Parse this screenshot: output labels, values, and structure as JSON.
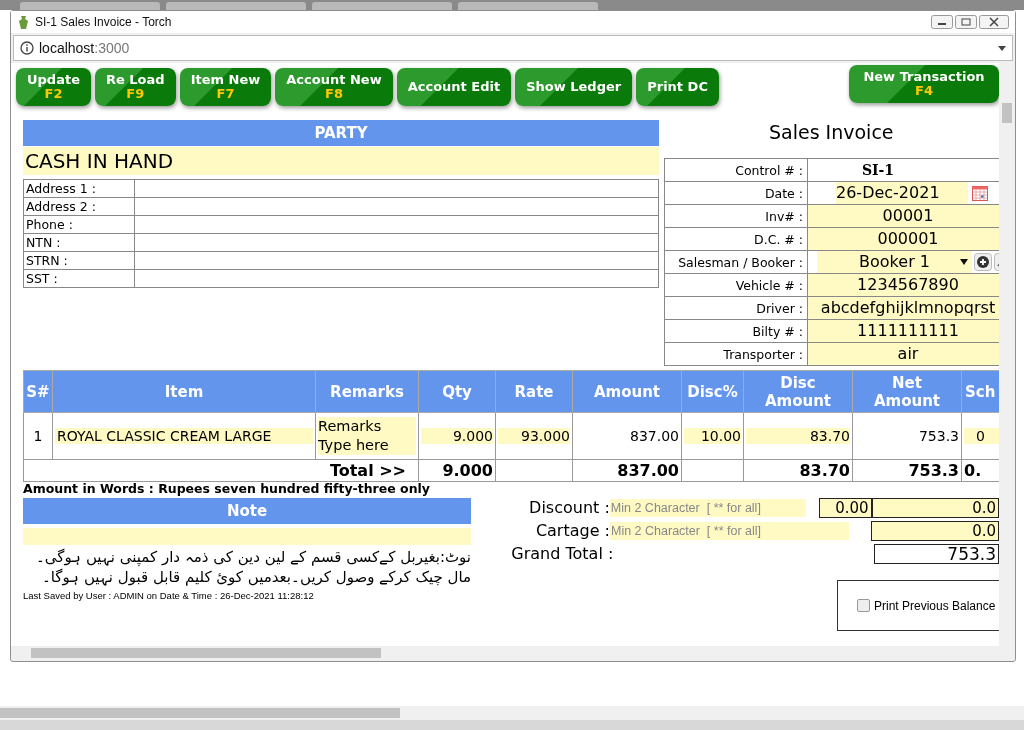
{
  "window": {
    "title": "SI-1 Sales Invoice - Torch"
  },
  "address_bar": {
    "host": "localhost",
    "port": ":3000"
  },
  "toolbar": [
    {
      "label": "Update",
      "shortcut": "F2"
    },
    {
      "label": "Re Load",
      "shortcut": "F9"
    },
    {
      "label": "Item New",
      "shortcut": "F7"
    },
    {
      "label": "Account New",
      "shortcut": "F8"
    },
    {
      "label": "Account Edit"
    },
    {
      "label": "Show Ledger"
    },
    {
      "label": "Print DC"
    }
  ],
  "new_transaction": {
    "label": "New Transaction",
    "shortcut": "F4"
  },
  "party": {
    "heading": "PARTY",
    "name": "CASH IN HAND",
    "fields": [
      {
        "label": "Address 1 :"
      },
      {
        "label": "Address 2 :"
      },
      {
        "label": "Phone :"
      },
      {
        "label": "NTN :"
      },
      {
        "label": "STRN :"
      },
      {
        "label": "SST :"
      }
    ]
  },
  "invoice": {
    "title": "Sales Invoice",
    "fields": [
      {
        "label": "Control # :",
        "kind": "static",
        "value": "SI-1"
      },
      {
        "label": "Date :",
        "kind": "date",
        "value": "26-Dec-2021"
      },
      {
        "label": "Inv# :",
        "kind": "input",
        "value": "00001"
      },
      {
        "label": "D.C. # :",
        "kind": "input",
        "value": "000001"
      },
      {
        "label": "Salesman / Booker :",
        "kind": "select",
        "value": "Booker 1"
      },
      {
        "label": "Vehicle # :",
        "kind": "input",
        "value": "1234567890"
      },
      {
        "label": "Driver :",
        "kind": "input",
        "value": "abcdefghijklmnopqrst"
      },
      {
        "label": "Bilty # :",
        "kind": "input",
        "value": "1111111111"
      },
      {
        "label": "Transporter :",
        "kind": "input",
        "value": "air"
      }
    ]
  },
  "table": {
    "columns": [
      "S#",
      "Item",
      "Remarks",
      "Qty",
      "Rate",
      "Amount",
      "Disc%",
      "Disc Amount",
      "Net Amount",
      "Sch"
    ],
    "rows": [
      {
        "sn": "1",
        "item": "ROYAL CLASSIC CREAM LARGE",
        "remarks": "Remarks Type here",
        "qty": "9.000",
        "rate": "93.000",
        "amount": "837.00",
        "disc_pct": "10.00",
        "disc_amount": "83.70",
        "net_amount": "753.3",
        "column_10": "0"
      }
    ],
    "total": {
      "label": "Total >>",
      "qty": "9.000",
      "amount": "837.00",
      "disc_amount": "83.70",
      "net_amount": "753.3",
      "column_10": "0."
    }
  },
  "amount_in_words": "Amount in Words : Rupees seven hundred fifty-three only",
  "note": {
    "heading": "Note",
    "lines": [
      "نوٹ:بغیربل کےکسی قسم کے لین دین کی ذمہ دار کمپنی نہیں ہوگی۔",
      "مال چیک کرکے وصول کریں۔بعدمیں کوئ کلیم قابل قبول نہیں ہوگا۔"
    ]
  },
  "last_saved": "Last Saved by User :  ADMIN  on Date & Time :  26-Dec-2021 11:28:12",
  "summary": {
    "discount": {
      "label": "Discount :",
      "placeholder": "Min 2 Character  [ ** for all]",
      "percent": "0.00",
      "value": "0.0"
    },
    "cartage": {
      "label": "Cartage :",
      "placeholder": "Min 2 Character  [ ** for all]",
      "value": "0.0"
    },
    "grand_total": {
      "label": "Grand Total :",
      "value": "753.3"
    }
  },
  "print_previous_balance": {
    "label": "Print Previous Balance",
    "checked": false
  }
}
